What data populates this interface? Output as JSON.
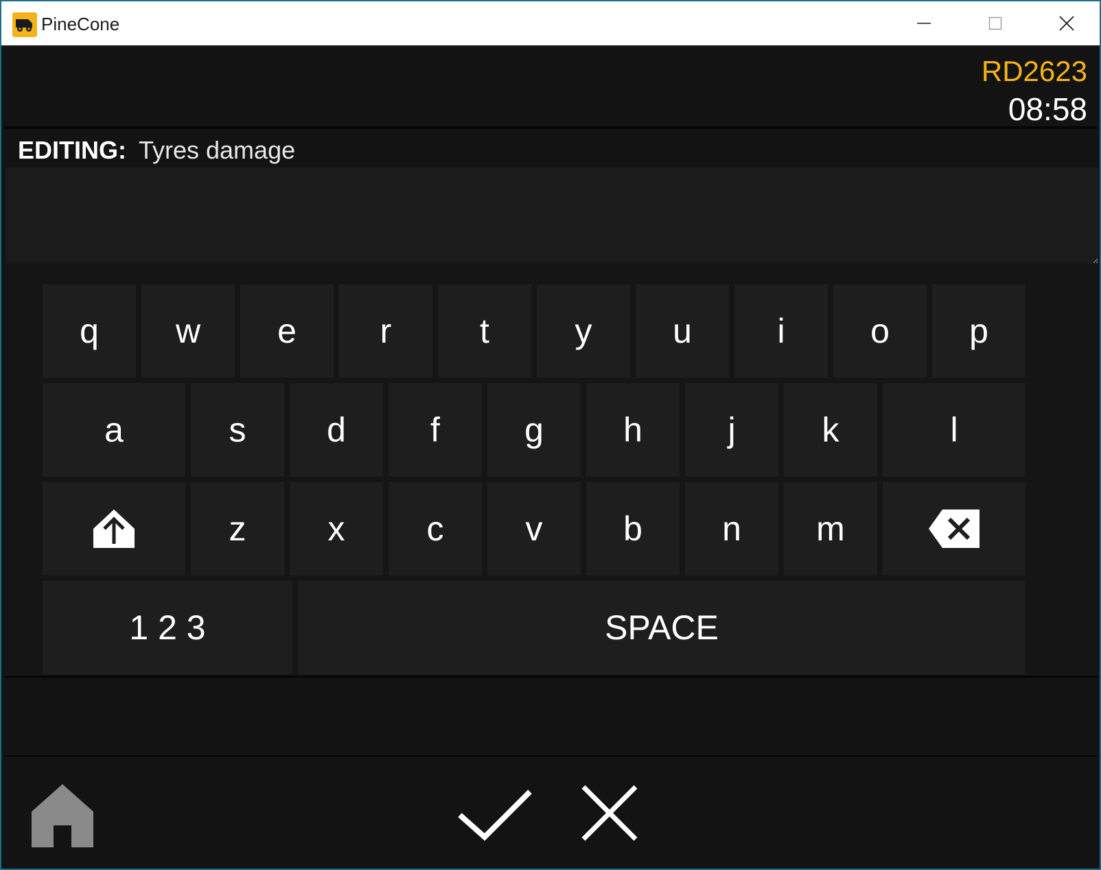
{
  "window": {
    "title": "PineCone",
    "controls": {
      "minimize": "minimize",
      "maximize": "maximize",
      "close": "close"
    }
  },
  "header": {
    "code": "RD2623",
    "time": "08:58",
    "code_color": "#f5b21b"
  },
  "editor": {
    "label": "EDITING:",
    "field_name": "Tyres damage",
    "value": "",
    "placeholder": ""
  },
  "keyboard": {
    "row1": [
      "q",
      "w",
      "e",
      "r",
      "t",
      "y",
      "u",
      "i",
      "o",
      "p"
    ],
    "row2": [
      "a",
      "s",
      "d",
      "f",
      "g",
      "h",
      "j",
      "k",
      "l"
    ],
    "row3": [
      "z",
      "x",
      "c",
      "v",
      "b",
      "n",
      "m"
    ],
    "shift_icon": "shift-arrow-up-icon",
    "backspace_icon": "backspace-icon",
    "numbers_label": "1 2 3",
    "space_label": "SPACE"
  },
  "footer": {
    "home_icon": "home-icon",
    "confirm_icon": "checkmark-icon",
    "cancel_icon": "close-x-icon"
  }
}
